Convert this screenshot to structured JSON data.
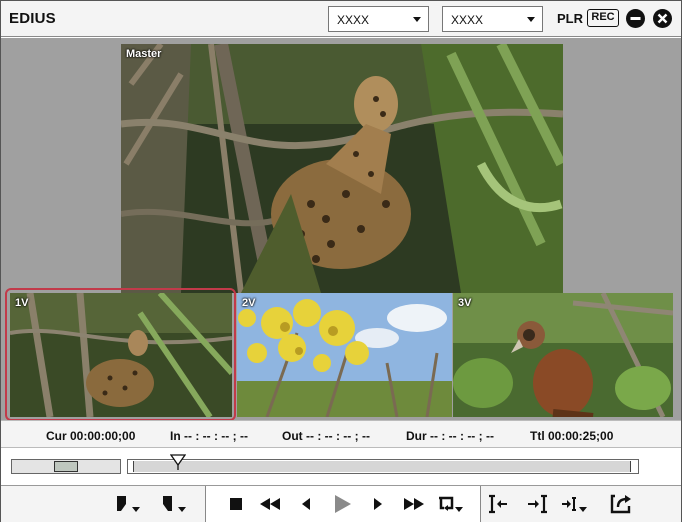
{
  "app": {
    "title": "EDIUS"
  },
  "header": {
    "combo1_value": "XXXX",
    "combo2_value": "XXXX",
    "plr_label": "PLR",
    "rec_label": "REC"
  },
  "viewer": {
    "master_label": "Master",
    "cams": [
      {
        "label": "1V",
        "selected": true
      },
      {
        "label": "2V",
        "selected": false
      },
      {
        "label": "3V",
        "selected": false
      }
    ],
    "selection_color": "#c23a4a"
  },
  "timecodes": {
    "cur": "Cur 00:00:00;00",
    "in": "In -- : -- : -- ; --",
    "out": "Out -- : -- : -- ; --",
    "dur": "Dur -- : -- : -- ; --",
    "ttl": "Ttl 00:00:25;00"
  },
  "playback": {
    "position_fraction": 0.09
  },
  "transport": {
    "left_buttons": [
      "set-in-icon",
      "set-out-icon"
    ],
    "center_buttons": [
      "stop-icon",
      "rewind-icon",
      "step-back-icon",
      "play-icon",
      "step-forward-icon",
      "fast-forward-icon",
      "loop-icon"
    ],
    "right_buttons": [
      "go-to-in-icon",
      "go-to-out-icon",
      "insert-icon",
      "overwrite-icon"
    ]
  }
}
